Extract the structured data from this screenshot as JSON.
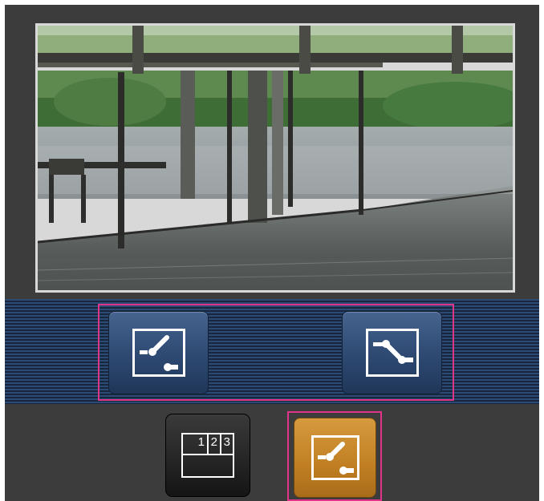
{
  "camera": {
    "view": "live-camera-image"
  },
  "controls": {
    "left_button": {
      "icon": "bird-view-icon"
    },
    "right_button": {
      "icon": "tilt-view-icon"
    }
  },
  "bottom": {
    "multi_screen": {
      "icon": "multi-screen-icon",
      "labels": [
        "1",
        "2",
        "3"
      ]
    },
    "camera_mode": {
      "icon": "bird-view-icon",
      "state": "selected"
    }
  },
  "colors": {
    "frame": "#3c3c3c",
    "strip": "#1f3454",
    "highlight": "#e0338a",
    "active_button": "#c07f22",
    "button_blue": "#2f4b74"
  }
}
